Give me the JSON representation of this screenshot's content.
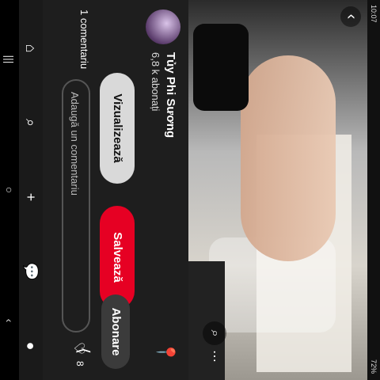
{
  "status": {
    "time": "10:07",
    "battery": "72%"
  },
  "author": {
    "name": "Tủy Phi Sương",
    "subscribers": "6,8 k abonați"
  },
  "buttons": {
    "view": "Vizualizează",
    "save": "Salvează",
    "subscribe": "Abonare"
  },
  "comments": {
    "label": "1 comentariu",
    "placeholder": "Adaugă un comentariu"
  },
  "reactions": {
    "count": "8"
  },
  "icons": {
    "back": "chevron-left-icon",
    "lens": "visual-search-icon",
    "menu": "more-icon",
    "pin": "pin-icon",
    "share": "share-icon",
    "heart": "heart-icon",
    "home": "home-icon",
    "search": "search-icon",
    "add": "plus-icon",
    "chat": "chat-icon",
    "profile": "profile-icon"
  },
  "colors": {
    "accent": "#e60023",
    "panel": "#1e1e1e"
  }
}
